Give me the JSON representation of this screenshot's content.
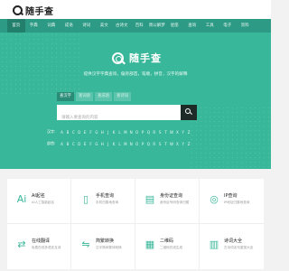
{
  "header": {
    "logo_text": "随手查"
  },
  "nav": {
    "items": [
      "首页",
      "字典",
      "词典",
      "成语",
      "诗词",
      "美文",
      "古诗文",
      "百科",
      "周公解梦",
      "星座",
      "查询",
      "工具",
      "电子",
      "资料"
    ]
  },
  "hero": {
    "title": "随手查",
    "slogan": "提供汉字字典查询，偏旁部首，笔顺，拼音，汉字的解释",
    "tabs": [
      "查汉字",
      "查词语",
      "查成语",
      "查诗词"
    ],
    "search_placeholder": "请输入要查询的内容",
    "letters_label_1": "汉字:",
    "letters_label_2": "部首:",
    "letters": [
      "A",
      "B",
      "C",
      "D",
      "E",
      "F",
      "G",
      "H",
      "J",
      "K",
      "L",
      "M",
      "N",
      "O",
      "P",
      "Q",
      "R",
      "S",
      "T",
      "W",
      "X",
      "Y",
      "Z"
    ]
  },
  "tools": [
    {
      "title": "AI起名",
      "subtitle": "AI人工智能起名",
      "icon": "ai-icon"
    },
    {
      "title": "手机查询",
      "subtitle": "手机归属地查询",
      "icon": "phone-icon"
    },
    {
      "title": "身份证查询",
      "subtitle": "身份证号码查询归属",
      "icon": "id-card-icon"
    },
    {
      "title": "IP查询",
      "subtitle": "IP地址归属地查询",
      "icon": "location-icon"
    },
    {
      "title": "在线翻译",
      "subtitle": "免费在线多语言互译",
      "icon": "translate-icon"
    },
    {
      "title": "简繁转换",
      "subtitle": "汉字简体繁体转换",
      "icon": "convert-icon"
    },
    {
      "title": "二维码",
      "subtitle": "二维码在线生成",
      "icon": "qrcode-icon"
    },
    {
      "title": "诗词大全",
      "subtitle": "古诗词名句鉴赏大全",
      "icon": "book-icon"
    }
  ]
}
